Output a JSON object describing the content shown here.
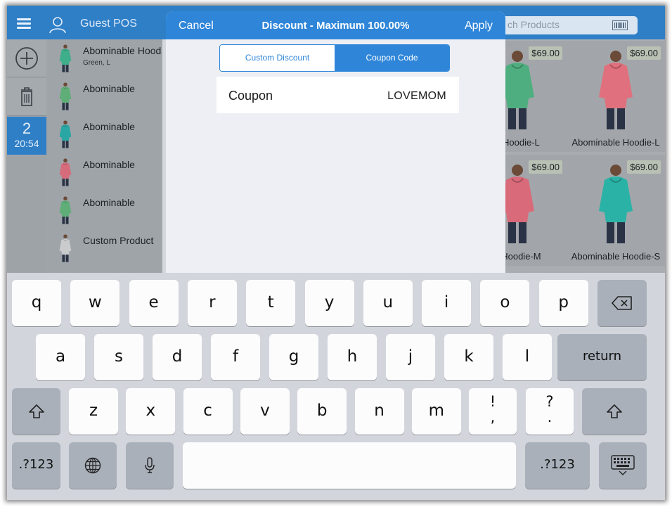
{
  "pos": {
    "title": "Guest POS",
    "search_placeholder_partial": "ch Products",
    "rail": {
      "count": "2",
      "time": "20:54"
    },
    "cart_items": [
      {
        "name": "Abominable Hood",
        "sub": "Green, L",
        "color": "#3fae8a"
      },
      {
        "name": "Abominable",
        "sub": "",
        "color": "#5fae78"
      },
      {
        "name": "Abominable",
        "sub": "",
        "color": "#2aa6a4"
      },
      {
        "name": "Abominable",
        "sub": "",
        "color": "#d66b7c"
      },
      {
        "name": "Abominable",
        "sub": "",
        "color": "#5fae78"
      },
      {
        "name": "Custom Product",
        "sub": "",
        "color": "#c9cbcd"
      }
    ],
    "products": [
      {
        "price": "$69.00",
        "name": "e Hoodie-L",
        "color": "#4fae7f"
      },
      {
        "price": "$69.00",
        "name": "Abominable Hoodie-L",
        "color": "#e0707d"
      },
      {
        "price": "$69.00",
        "name": "e Hoodie-M",
        "color": "#d96a7a"
      },
      {
        "price": "$69.00",
        "name": "Abominable Hoodie-S",
        "color": "#2bb2a6"
      }
    ]
  },
  "modal": {
    "cancel": "Cancel",
    "title": "Discount - Maximum 100.00%",
    "apply": "Apply",
    "tabs": {
      "custom": "Custom Discount",
      "coupon": "Coupon Code"
    },
    "coupon_label": "Coupon",
    "coupon_value": "LOVEMOM"
  },
  "keyboard": {
    "row1": [
      "q",
      "w",
      "e",
      "r",
      "t",
      "y",
      "u",
      "i",
      "o",
      "p"
    ],
    "row2": [
      "a",
      "s",
      "d",
      "f",
      "g",
      "h",
      "j",
      "k",
      "l"
    ],
    "row3": [
      "z",
      "x",
      "c",
      "v",
      "b",
      "n",
      "m"
    ],
    "punct1": {
      "top": "!",
      "bottom": ","
    },
    "punct2": {
      "top": "?",
      "bottom": "."
    },
    "return": "return",
    "numbers": ".?123"
  },
  "colors": {
    "accent": "#2f86d9",
    "bar": "#2f7fc7"
  }
}
